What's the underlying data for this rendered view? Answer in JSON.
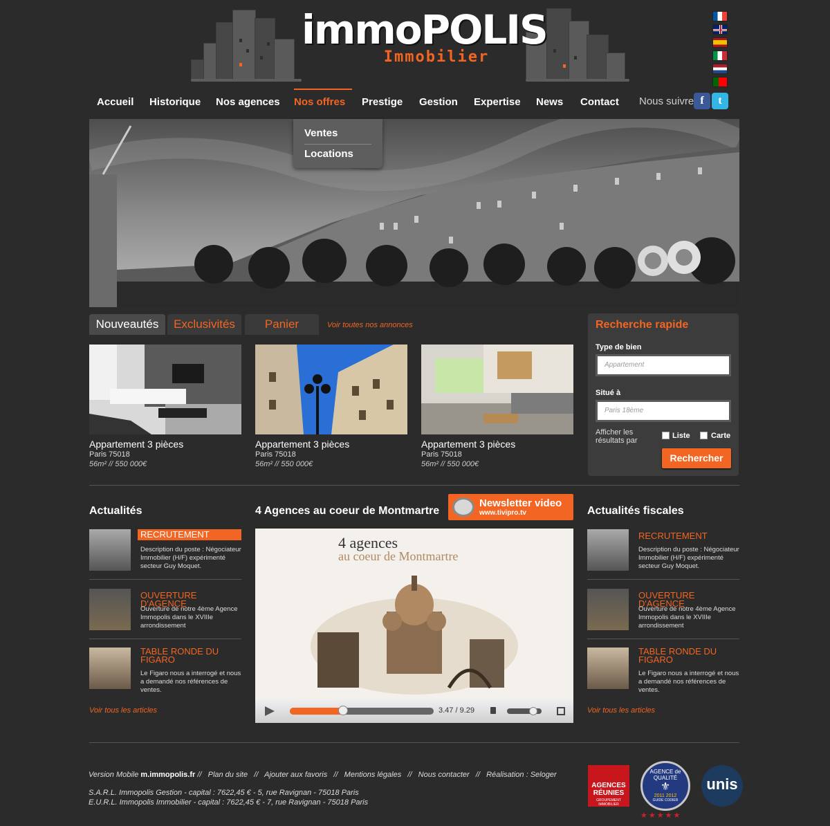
{
  "brand": {
    "name": "immoPOLIS",
    "tagline": "Immobilier"
  },
  "flags": [
    "fr-flag-icon",
    "uk-flag-icon",
    "es-flag-icon",
    "it-flag-icon",
    "nl-flag-icon",
    "pt-flag-icon"
  ],
  "nav": {
    "items": [
      "Accueil",
      "Historique",
      "Nos agences",
      "Nos offres",
      "Prestige",
      "Gestion",
      "Expertise",
      "News",
      "Contact"
    ],
    "active": "Nos offres",
    "follow": "Nous suivre",
    "dropdown": [
      "Ventes",
      "Locations"
    ]
  },
  "tabs": {
    "items": [
      "Nouveautés",
      "Exclusivités",
      "Panier"
    ],
    "see_all": "Voir toutes nos annonces"
  },
  "listings": [
    {
      "title": "Appartement 3 pièces",
      "city": "Paris 75018",
      "details": "56m²  //  550 000€"
    },
    {
      "title": "Appartement 3 pièces",
      "city": "Paris 75018",
      "details": "56m²  //  550 000€"
    },
    {
      "title": "Appartement 3 pièces",
      "city": "Paris 75018",
      "details": "56m²  //  550 000€"
    }
  ],
  "search": {
    "title": "Recherche rapide",
    "type_label": "Type de bien",
    "type_placeholder": "Appartement",
    "location_label": "Situé à",
    "location_placeholder": "Paris 18ème",
    "display_label": "Afficher les résultats par",
    "opt_list": "Liste",
    "opt_map": "Carte",
    "button": "Rechercher"
  },
  "news": {
    "title": "Actualités",
    "see_all": "Voir tous les articles",
    "items": [
      {
        "title": "RECRUTEMENT",
        "desc": "Description du poste : Négociateur Immobilier (H/F) expérimenté secteur Guy Moquet."
      },
      {
        "title": "OUVERTURE D'AGENCE",
        "desc": "Ouverture de notre 4ème Agence Immopolis dans le XVIIIe arrondissement"
      },
      {
        "title": "TABLE RONDE DU FIGARO",
        "desc": "Le Figaro nous a interrogé et nous a demandé nos références de ventes."
      }
    ]
  },
  "fiscal": {
    "title": "Actualités fiscales",
    "see_all": "Voir tous les articles",
    "items": [
      {
        "title": "RECRUTEMENT",
        "desc": "Description du poste : Négociateur Immobilier (H/F) expérimenté secteur Guy Moquet."
      },
      {
        "title": "OUVERTURE D'AGENCE",
        "desc": "Ouverture de notre 4ème Agence Immopolis dans le XVIIIe arrondissement"
      },
      {
        "title": "TABLE RONDE DU FIGARO",
        "desc": "Le Figaro nous a interrogé et nous a demandé nos références de ventes."
      }
    ]
  },
  "video": {
    "section_title": "4 Agences au coeur de Montmartre",
    "title_line1": "4 agences",
    "title_line2": "au coeur de Montmartre",
    "time": "3.47 / 9.29",
    "progress": 0.37,
    "volume": 0.75
  },
  "newsletter": {
    "label": "Newsletter video",
    "url": "www.tivipro.tv"
  },
  "footer": {
    "links_prefix": "Version Mobile",
    "mobile_url": "m.immopolis.fr",
    "links": "//   Plan du site   //   Ajouter aux favoris   //   Mentions légales   //   Nous contacter   //   Réalisation : Seloger",
    "line2": "S.A.R.L. Immopolis Gestion - capital : 7622,45 € - 5, rue Ravignan - 75018 Paris",
    "line3": "E.U.R.L. Immopolis Immobilier - capital : 7622,45 € - 7, rue Ravignan - 75018 Paris",
    "badges": {
      "agences": "AGENCES RÉUNIES",
      "agences_sub": "GROUPEMENT IMMOBILIER",
      "qualite": "AGENCE de QUALITÉ",
      "qualite_years": "2011  2012",
      "qualite_sub": "GUIDE CODIER",
      "unis": "unis"
    }
  },
  "colors": {
    "accent": "#f26522",
    "background": "#2b2b2b"
  }
}
